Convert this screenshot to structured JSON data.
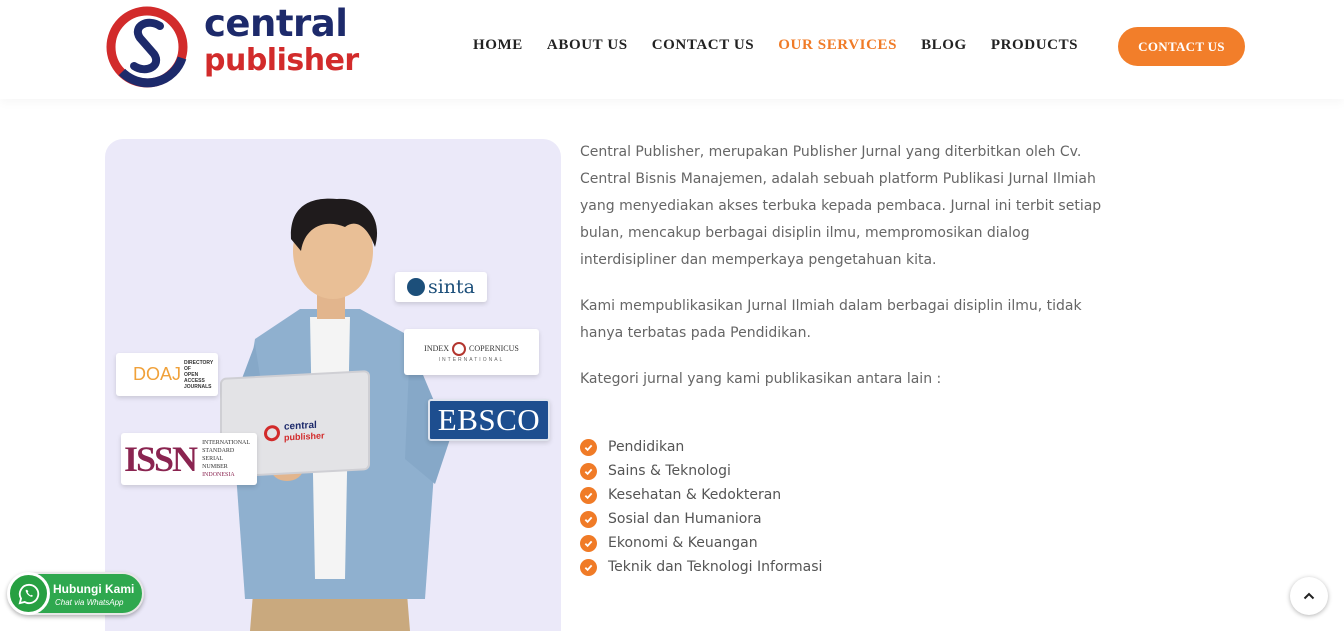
{
  "brand": {
    "line1": "central",
    "line2": "publisher"
  },
  "nav": {
    "items": [
      {
        "label": "HOME"
      },
      {
        "label": "ABOUT US"
      },
      {
        "label": "CONTACT US"
      },
      {
        "label": "OUR SERVICES",
        "active": true
      },
      {
        "label": "BLOG"
      },
      {
        "label": "PRODUCTS"
      }
    ],
    "cta_label": "CONTACT US"
  },
  "hero": {
    "laptop_logo": {
      "line1": "central",
      "line2": "publisher"
    },
    "badges": {
      "sinta": "sinta",
      "index_copernicus": {
        "line1": "INDEX",
        "line2": "COPERNICUS",
        "line3": "INTERNATIONAL"
      },
      "doaj": {
        "mark": "DOAJ",
        "line1": "DIRECTORY OF",
        "line2": "OPEN ACCESS",
        "line3": "JOURNALS"
      },
      "ebsco": "EBSCO",
      "issn": {
        "mark": "ISSN",
        "line1": "INTERNATIONAL",
        "line2": "STANDARD",
        "line3": "SERIAL",
        "line4": "NUMBER",
        "line5": "INDONESIA"
      }
    }
  },
  "content": {
    "paragraph1": "Central Publisher, merupakan Publisher Jurnal yang diterbitkan oleh Cv. Central Bisnis Manajemen, adalah sebuah platform Publikasi Jurnal Ilmiah yang menyediakan akses terbuka kepada pembaca. Jurnal ini terbit setiap bulan, mencakup berbagai disiplin ilmu, mempromosikan dialog interdisipliner dan memperkaya pengetahuan kita.",
    "paragraph2": "Kami mempublikasikan Jurnal Ilmiah dalam berbagai disiplin ilmu, tidak hanya terbatas pada Pendidikan.",
    "paragraph3": "Kategori jurnal yang kami publikasikan antara lain :",
    "categories": [
      "Pendidikan",
      "Sains & Teknologi",
      "Kesehatan & Kedokteran",
      "Sosial dan Humaniora",
      "Ekonomi & Keuangan",
      "Teknik dan Teknologi Informasi"
    ]
  },
  "whatsapp": {
    "title": "Hubungi Kami",
    "subtitle": "Chat via WhatsApp"
  },
  "colors": {
    "accent": "#f27e2a",
    "brand_blue": "#1d2a6b",
    "brand_red": "#d22b2b",
    "whatsapp": "#2fa84f"
  }
}
